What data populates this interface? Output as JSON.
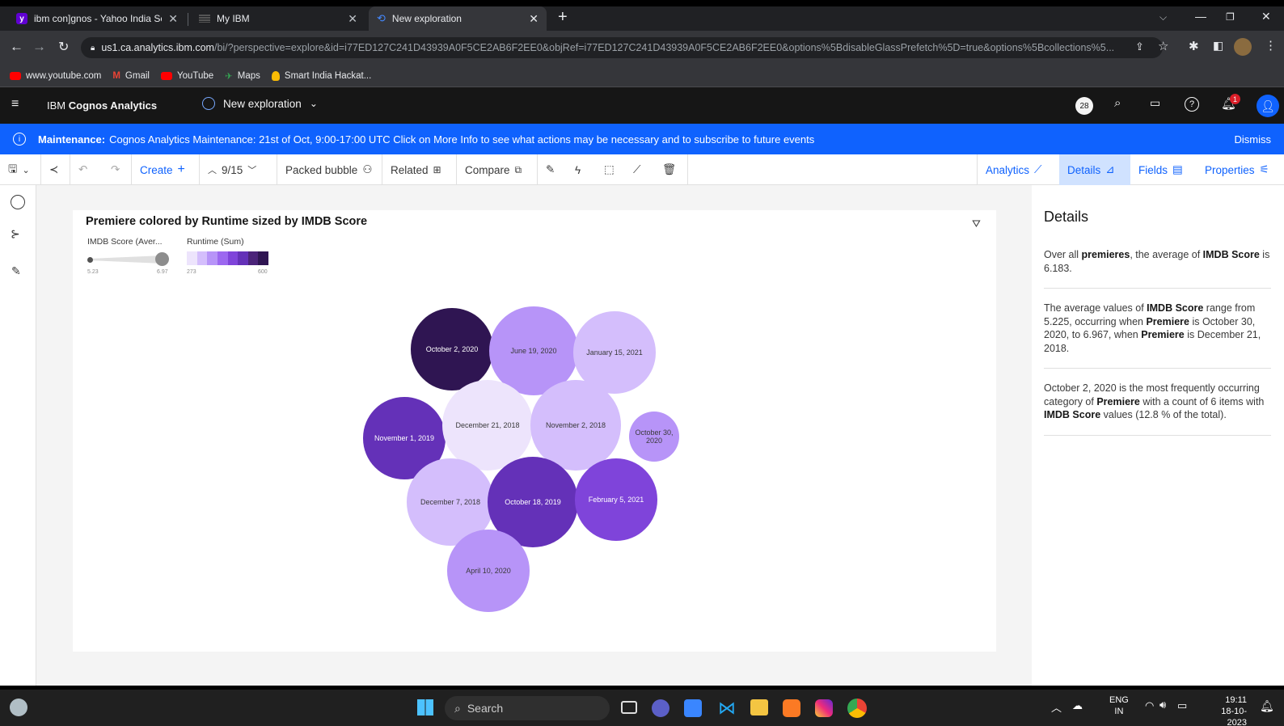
{
  "browser": {
    "tabs": [
      {
        "title": "ibm con]gnos - Yahoo India Sea",
        "icon": "yahoo-icon"
      },
      {
        "title": "My IBM",
        "icon": "ibm-icon"
      },
      {
        "title": "New exploration",
        "icon": "cognos-icon"
      }
    ],
    "new_tab": "+",
    "url_host": "us1.ca.analytics.ibm.com",
    "url_path": "/bi/?perspective=explore&id=i77ED127C241D43939A0F5CE2AB6F2EE0&objRef=i77ED127C241D43939A0F5CE2AB6F2EE0&options%5BdisableGlassPrefetch%5D=true&options%5Bcollections%5...",
    "bookmarks": [
      {
        "label": "www.youtube.com",
        "color": "#ff0000"
      },
      {
        "label": "Gmail",
        "color": "#ea4335"
      },
      {
        "label": "YouTube",
        "color": "#ff0000"
      },
      {
        "label": "Maps",
        "color": "#34a853"
      },
      {
        "label": "Smart India Hackat...",
        "color": "#fbbc04"
      }
    ]
  },
  "app": {
    "brand_prefix": "IBM",
    "brand_name": "Cognos Analytics",
    "exploration_title": "New exploration",
    "badge_count": "28",
    "notification_count": "1"
  },
  "banner": {
    "label": "Maintenance:",
    "text": "Cognos Analytics Maintenance: 21st of Oct, 9:00-17:00 UTC Click on More Info to see what actions may be necessary and to subscribe to future events",
    "dismiss": "Dismiss"
  },
  "toolbar": {
    "create": "Create",
    "create_plus": "+",
    "page": "9/15",
    "viz": "Packed bubble",
    "related": "Related",
    "compare": "Compare",
    "analytics": "Analytics",
    "details": "Details",
    "fields": "Fields",
    "properties": "Properties"
  },
  "chart": {
    "title": "Premiere colored by Runtime sized by IMDB Score",
    "size_legend": {
      "label": "IMDB Score (Aver...",
      "min": "5.23",
      "max": "6.97"
    },
    "color_legend": {
      "label": "Runtime (Sum)",
      "min": "273",
      "max": "600"
    }
  },
  "chart_data": {
    "type": "packed bubble",
    "title": "Premiere colored by Runtime sized by IMDB Score",
    "size_measure": "IMDB Score (Average)",
    "color_measure": "Runtime (Sum)",
    "size_range": [
      5.23,
      6.97
    ],
    "color_range": [
      273,
      600
    ],
    "colors": [
      "#ede4fc",
      "#d4befc",
      "#b794f8",
      "#9c68f0",
      "#7f44da",
      "#6431b8",
      "#4b2379",
      "#2f1552"
    ],
    "points": [
      {
        "label": "October 2, 2020",
        "size": 6.6,
        "runtime": 590
      },
      {
        "label": "June 19, 2020",
        "size": 6.9,
        "runtime": 360
      },
      {
        "label": "January 15, 2021",
        "size": 6.6,
        "runtime": 300
      },
      {
        "label": "November 1, 2019",
        "size": 6.6,
        "runtime": 500
      },
      {
        "label": "December 21, 2018",
        "size": 6.97,
        "runtime": 273
      },
      {
        "label": "November 2, 2018",
        "size": 6.95,
        "runtime": 320
      },
      {
        "label": "October 30, 2020",
        "size": 5.23,
        "runtime": 380
      },
      {
        "label": "December 7, 2018",
        "size": 6.8,
        "runtime": 320
      },
      {
        "label": "October 18, 2019",
        "size": 6.95,
        "runtime": 490
      },
      {
        "label": "February 5, 2021",
        "size": 6.6,
        "runtime": 450
      },
      {
        "label": "April 10, 2020",
        "size": 6.6,
        "runtime": 380
      }
    ]
  },
  "details": {
    "title": "Details",
    "p1": [
      {
        "t": "Over all "
      },
      {
        "t": "premieres",
        "b": true
      },
      {
        "t": ", the average of "
      },
      {
        "t": "IMDB Score",
        "b": true
      },
      {
        "t": " is 6.183."
      }
    ],
    "p2": [
      {
        "t": "The average values of "
      },
      {
        "t": "IMDB Score",
        "b": true
      },
      {
        "t": " range from 5.225, occurring when "
      },
      {
        "t": "Premiere",
        "b": true
      },
      {
        "t": " is October 30, 2020, to 6.967, when "
      },
      {
        "t": "Premiere",
        "b": true
      },
      {
        "t": " is December 21, 2018."
      }
    ],
    "p3": [
      {
        "t": "October 2, 2020 is the most frequently occurring category of "
      },
      {
        "t": "Premiere",
        "b": true
      },
      {
        "t": " with a count of 6 items with "
      },
      {
        "t": "IMDB Score",
        "b": true
      },
      {
        "t": " values (12.8 % of the total)."
      }
    ]
  },
  "taskbar": {
    "search": "Search",
    "lang": "ENG",
    "region": "IN",
    "time": "19:11",
    "date": "18-10-2023"
  }
}
